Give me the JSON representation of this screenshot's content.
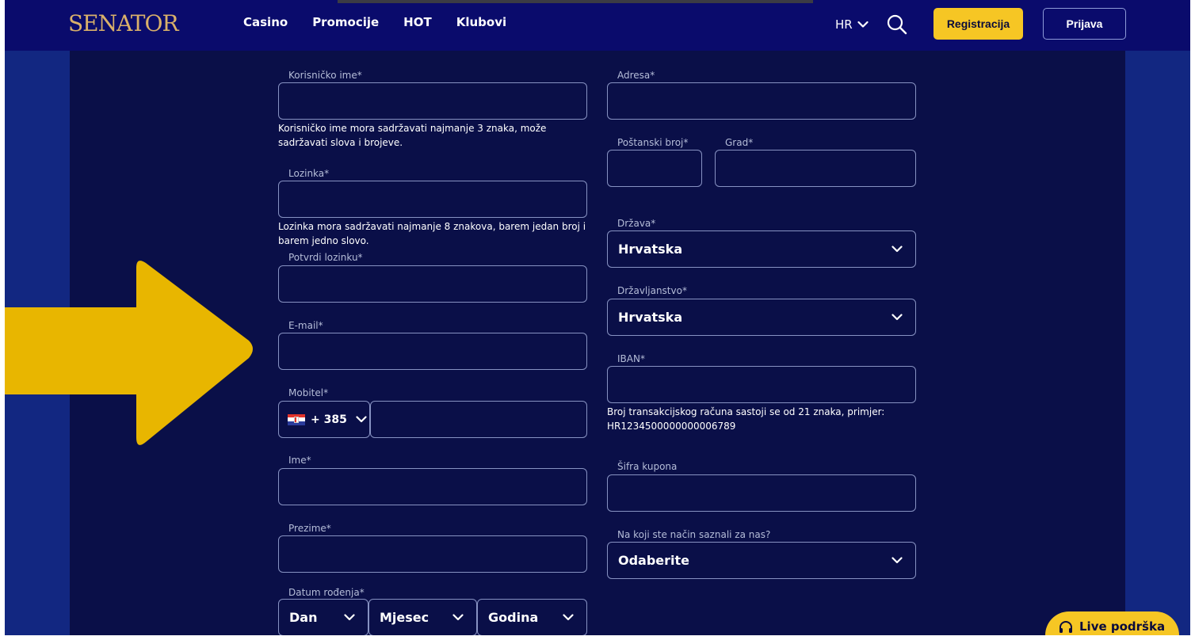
{
  "header": {
    "logo": "SENATOR",
    "nav": [
      "Casino",
      "Promocije",
      "HOT",
      "Klubovi"
    ],
    "language": "HR",
    "register_label": "Registracija",
    "login_label": "Prijava"
  },
  "form": {
    "username": {
      "label": "Korisničko ime*",
      "help": "Korisničko ime mora sadržavati najmanje 3 znaka, može sadržavati slova i brojeve."
    },
    "password": {
      "label": "Lozinka*",
      "help": "Lozinka mora sadržavati najmanje 8 znakova, barem jedan broj i barem jedno slovo."
    },
    "confirm_password": {
      "label": "Potvrdi lozinku*"
    },
    "email": {
      "label": "E-mail*"
    },
    "mobile": {
      "label": "Mobitel*",
      "country_code": "+ 385"
    },
    "first_name": {
      "label": "Ime*"
    },
    "last_name": {
      "label": "Prezime*"
    },
    "birth_date": {
      "label": "Datum rođenja*",
      "day": "Dan",
      "month": "Mjesec",
      "year": "Godina"
    },
    "address": {
      "label": "Adresa*"
    },
    "postal_code": {
      "label": "Poštanski broj*"
    },
    "city": {
      "label": "Grad*"
    },
    "country": {
      "label": "Država*",
      "value": "Hrvatska"
    },
    "citizenship": {
      "label": "Državljanstvo*",
      "value": "Hrvatska"
    },
    "iban": {
      "label": "IBAN*",
      "help": "Broj transakcijskog računa sastoji se od 21 znaka, primjer: HR1234500000000006789"
    },
    "coupon": {
      "label": "Šifra kupona"
    },
    "referral": {
      "label": "Na koji ste način saznali za nas?",
      "value": "Odaberite"
    }
  },
  "live_support": {
    "label": "Live podrška"
  },
  "colors": {
    "header_bg": "#0a0b6c",
    "content_bg": "#0a0f48",
    "side_bg": "#122781",
    "accent": "#f6c624",
    "arrow": "#e8b600"
  }
}
